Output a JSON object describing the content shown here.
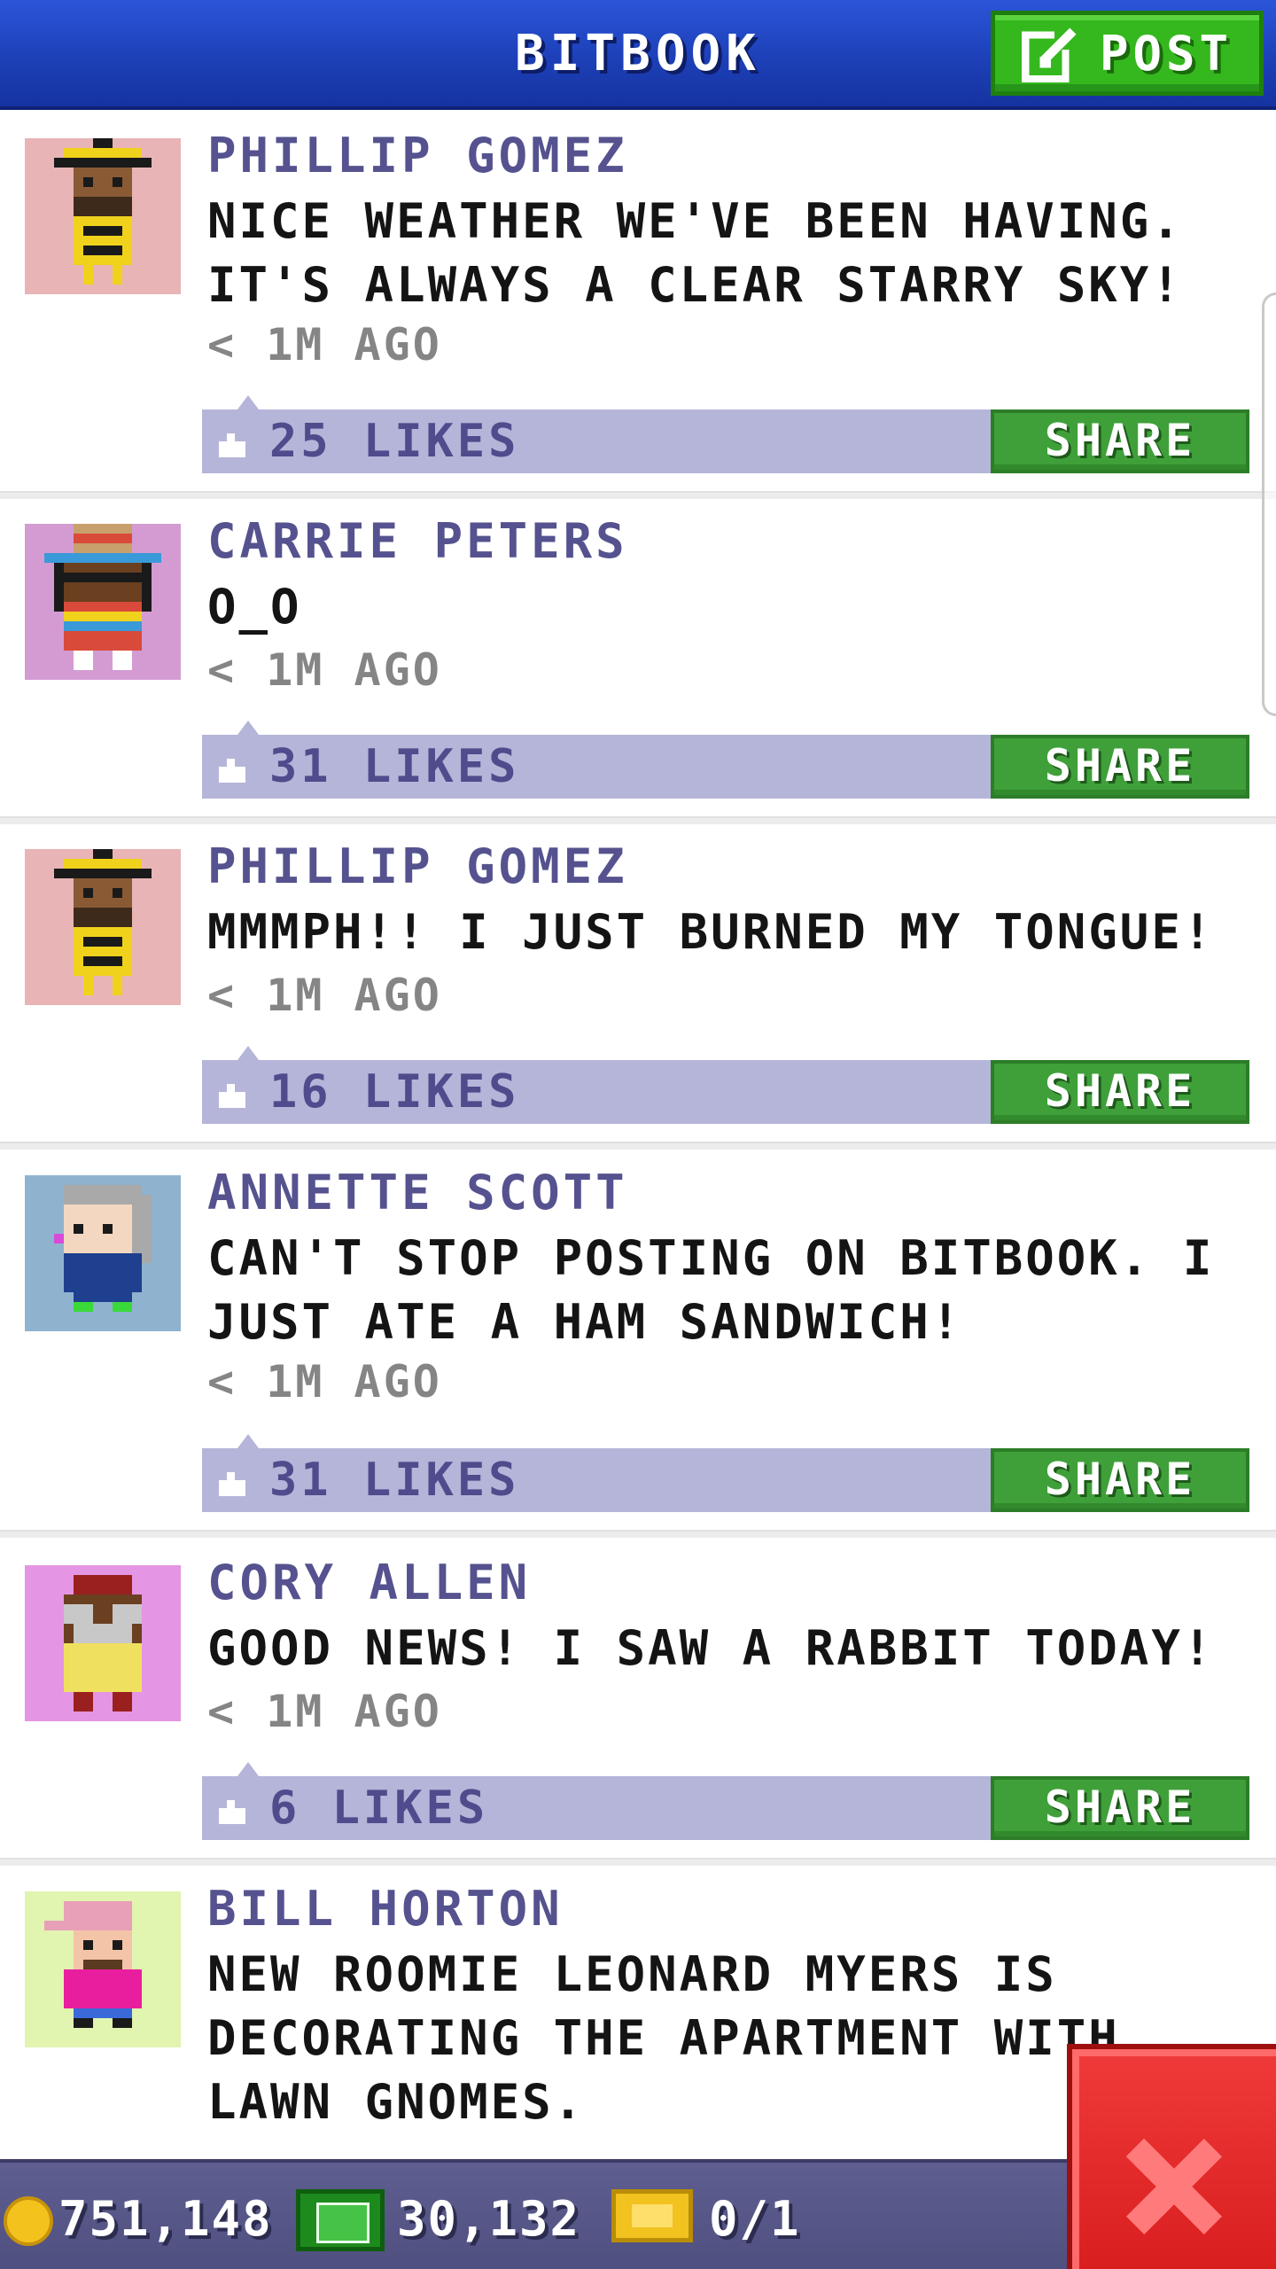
{
  "header": {
    "title": "BITBOOK",
    "post_label": "POST",
    "post_icon": "compose-icon"
  },
  "posts": [
    {
      "author": "PHILLIP GOMEZ",
      "message": "NICE WEATHER WE'VE BEEN HAVING. IT'S ALWAYS A CLEAR STARRY SKY!",
      "time": "< 1M AGO",
      "likes": "25 LIKES",
      "share_label": "SHARE",
      "avatar_bg": "#e8b4b6"
    },
    {
      "author": "CARRIE PETERS",
      "message": "O_O",
      "time": "< 1M AGO",
      "likes": "31 LIKES",
      "share_label": "SHARE",
      "avatar_bg": "#d49bd2"
    },
    {
      "author": "PHILLIP GOMEZ",
      "message": "MMMPH!! I JUST BURNED MY TONGUE!",
      "time": "< 1M AGO",
      "likes": "16 LIKES",
      "share_label": "SHARE",
      "avatar_bg": "#e8b4b6"
    },
    {
      "author": "ANNETTE SCOTT",
      "message": "CAN'T STOP POSTING ON BITBOOK. I JUST ATE A HAM SANDWICH!",
      "time": "< 1M AGO",
      "likes": "31 LIKES",
      "share_label": "SHARE",
      "avatar_bg": "#8fb3cf"
    },
    {
      "author": "CORY ALLEN",
      "message": "GOOD NEWS! I SAW A RABBIT TODAY!",
      "time": "< 1M AGO",
      "likes": "6 LIKES",
      "share_label": "SHARE",
      "avatar_bg": "#e495e3"
    },
    {
      "author": "BILL HORTON",
      "message": "NEW ROOMIE LEONARD MYERS IS DECORATING THE APARTMENT WITH LAWN GNOMES.",
      "time": "",
      "likes": "",
      "share_label": "",
      "avatar_bg": "#e1f4b0"
    }
  ],
  "status_bar": {
    "coins": "751,148",
    "bux": "30,132",
    "tickets": "0/1",
    "coin_icon": "coin-icon",
    "bux_icon": "cash-icon",
    "ticket_icon": "ticket-icon"
  },
  "close_icon": "close-icon",
  "colors": {
    "header_blue": "#1d40b8",
    "post_green": "#35b81d",
    "share_green": "#3fa03a",
    "likes_lavender": "#b5b5d9",
    "author_purple": "#55528f",
    "close_red": "#d91e1e"
  }
}
